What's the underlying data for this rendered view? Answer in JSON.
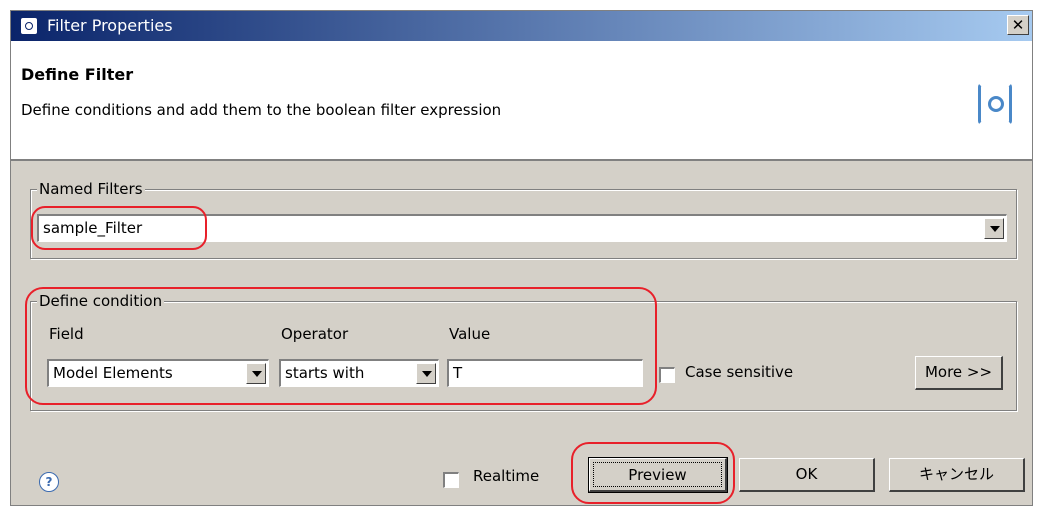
{
  "window": {
    "title": "Filter Properties",
    "close_glyph": "✕"
  },
  "header": {
    "title": "Define Filter",
    "description": "Define conditions and add them to the boolean filter expression",
    "icon": "filter-icon"
  },
  "named_filters": {
    "legend": "Named Filters",
    "selected": "sample_Filter"
  },
  "condition": {
    "legend": "Define condition",
    "field_label": "Field",
    "operator_label": "Operator",
    "value_label": "Value",
    "field_selected": "Model Elements",
    "operator_selected": "starts with",
    "value": "T",
    "case_sensitive_label": "Case sensitive",
    "case_sensitive_checked": false,
    "more_button": "More >>"
  },
  "footer": {
    "help_glyph": "?",
    "realtime_label": "Realtime",
    "realtime_checked": false,
    "preview_button": "Preview",
    "ok_button": "OK",
    "cancel_button": "キャンセル"
  },
  "colors": {
    "annotation": "#e8202a",
    "title_bar": "#0a246a",
    "dialog_bg": "#d4d0c8"
  }
}
